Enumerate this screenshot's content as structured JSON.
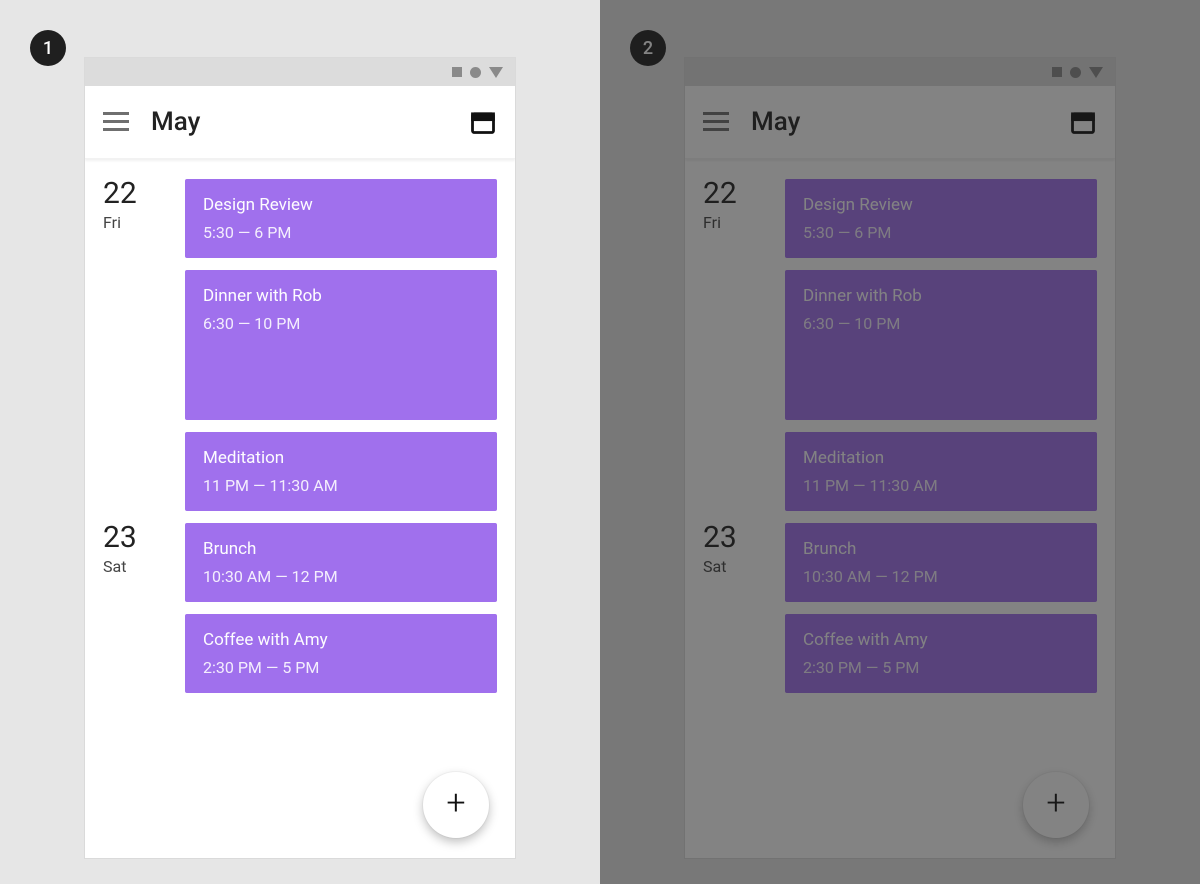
{
  "badges": {
    "left": "1",
    "right": "2"
  },
  "appbar": {
    "title": "May"
  },
  "fab_label": "+",
  "days": [
    {
      "num": "22",
      "dow": "Fri",
      "events": [
        {
          "title": "Design Review",
          "time": "5:30 — 6 PM",
          "tall": false
        },
        {
          "title": "Dinner with Rob",
          "time": "6:30 — 10 PM",
          "tall": true
        },
        {
          "title": "Meditation",
          "time": "11 PM — 11:30 AM",
          "tall": false
        }
      ]
    },
    {
      "num": "23",
      "dow": "Sat",
      "events": [
        {
          "title": "Brunch",
          "time": "10:30 AM — 12 PM",
          "tall": false
        },
        {
          "title": "Coffee with Amy",
          "time": "2:30 PM — 5 PM",
          "tall": false
        }
      ]
    }
  ],
  "colors": {
    "event_bg": "#a070ed",
    "panel_bg": "#e6e6e6"
  }
}
